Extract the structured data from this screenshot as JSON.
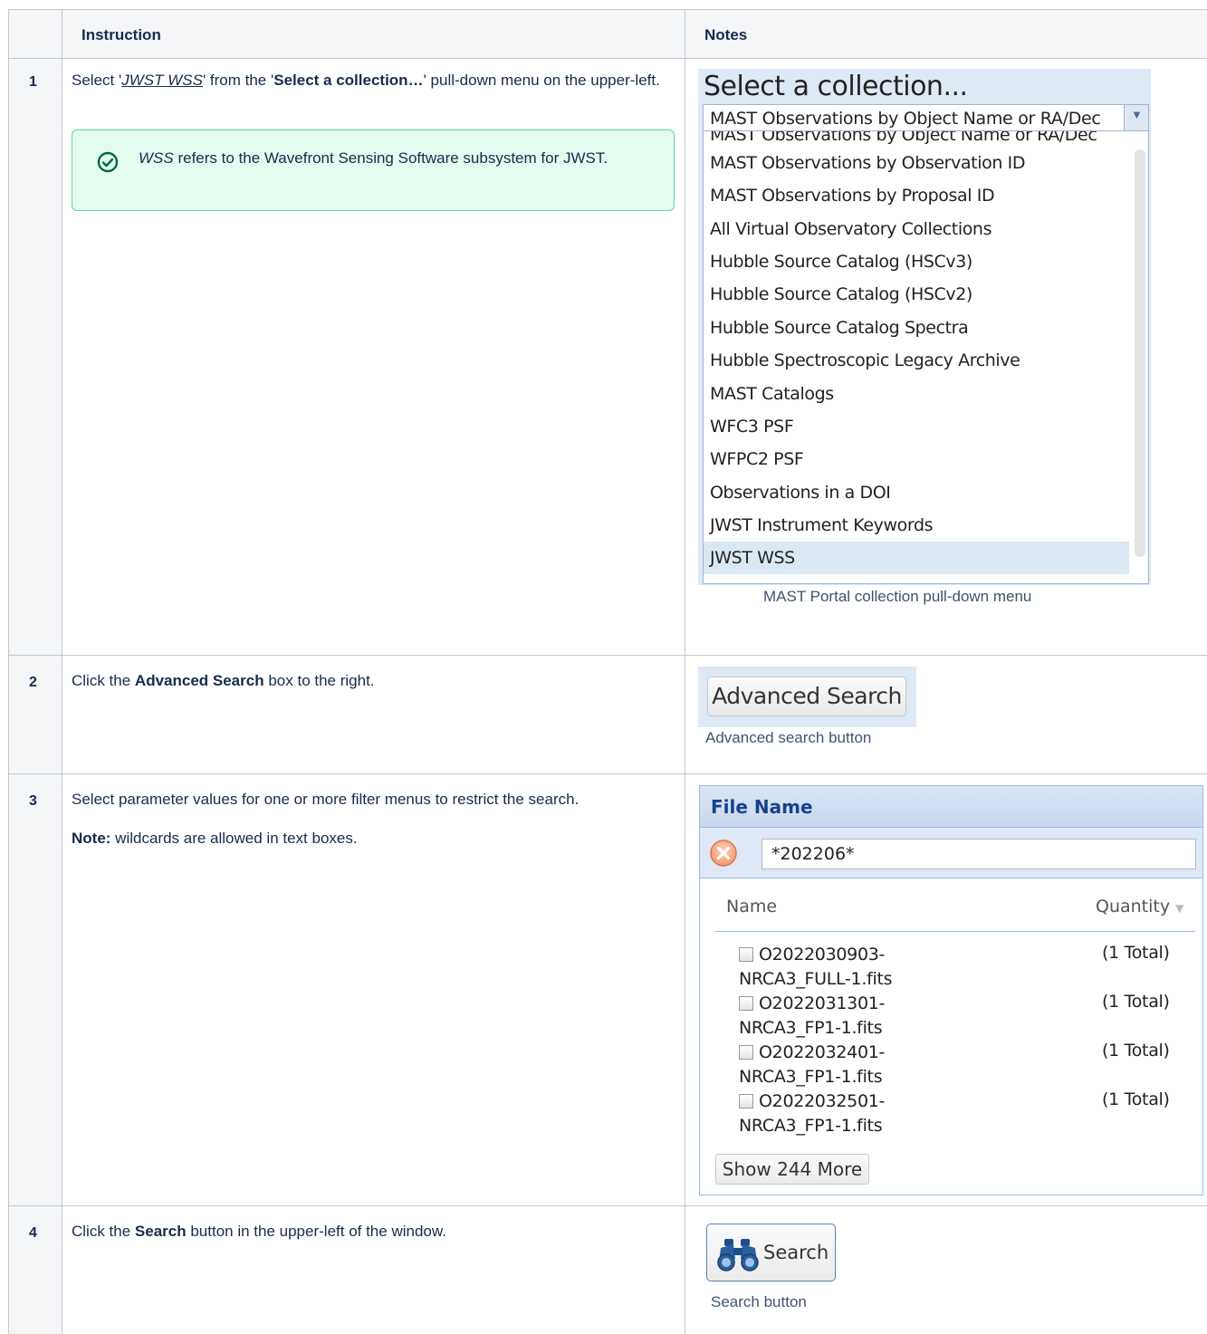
{
  "table": {
    "headers": {
      "instruction": "Instruction",
      "notes": "Notes"
    },
    "rows": [
      {
        "num": "1",
        "text_a": "Select '",
        "link": "JWST WSS",
        "text_b": "' from the '",
        "bold": "Select a collection…",
        "text_c": "' pull-down menu on the upper-left.",
        "info": {
          "italic": "WSS",
          "text": " refers to the Wavefront Sensing Software subsystem for JWST."
        },
        "caption": "MAST Portal collection pull-down menu"
      },
      {
        "num": "2",
        "text_a": "Click the ",
        "bold": "Advanced Search",
        "text_b": " box to the right.",
        "caption": "Advanced search button"
      },
      {
        "num": "3",
        "text": "Select parameter values for one or more filter menus to restrict the search.",
        "note_bold": "Note:",
        "note_text": " wildcards are allowed in text boxes."
      },
      {
        "num": "4",
        "text_a": "Click the ",
        "bold": "Search",
        "text_b": " button in the upper-left of the window.",
        "caption": "Search button"
      }
    ]
  },
  "collection_menu": {
    "title": "Select a collection...",
    "selected": "MAST Observations by Object Name or RA/Dec",
    "options": [
      "MAST Observations by Object Name or RA/Dec",
      "MAST Observations by Observation ID",
      "MAST Observations by Proposal ID",
      "All Virtual Observatory Collections",
      "Hubble Source Catalog (HSCv3)",
      "Hubble Source Catalog (HSCv2)",
      "Hubble Source Catalog Spectra",
      "Hubble Spectroscopic Legacy Archive",
      "MAST Catalogs",
      "WFC3 PSF",
      "WFPC2 PSF",
      "Observations in a DOI",
      "JWST Instrument Keywords",
      "JWST WSS"
    ]
  },
  "advanced_search": {
    "label": "Advanced Search"
  },
  "file_filter": {
    "title": "File Name",
    "value": "*202206*",
    "col_name": "Name",
    "col_qty": "Quantity",
    "items": [
      {
        "line1": "O2022030903-",
        "line2": "NRCA3_FULL-1.fits",
        "qty": "(1 Total)"
      },
      {
        "line1": "O2022031301-",
        "line2": "NRCA3_FP1-1.fits",
        "qty": "(1 Total)"
      },
      {
        "line1": "O2022032401-",
        "line2": "NRCA3_FP1-1.fits",
        "qty": "(1 Total)"
      },
      {
        "line1": "O2022032501-",
        "line2": "NRCA3_FP1-1.fits",
        "qty": "(1 Total)"
      }
    ],
    "more": "Show 244 More"
  },
  "search_button": {
    "label": "Search",
    "icon": "binoculars-icon"
  },
  "colors": {
    "header_bg": "#f4f5f7",
    "success_bg": "#e3fcef",
    "success_border": "#57d9a3",
    "success_icon": "#006644"
  }
}
